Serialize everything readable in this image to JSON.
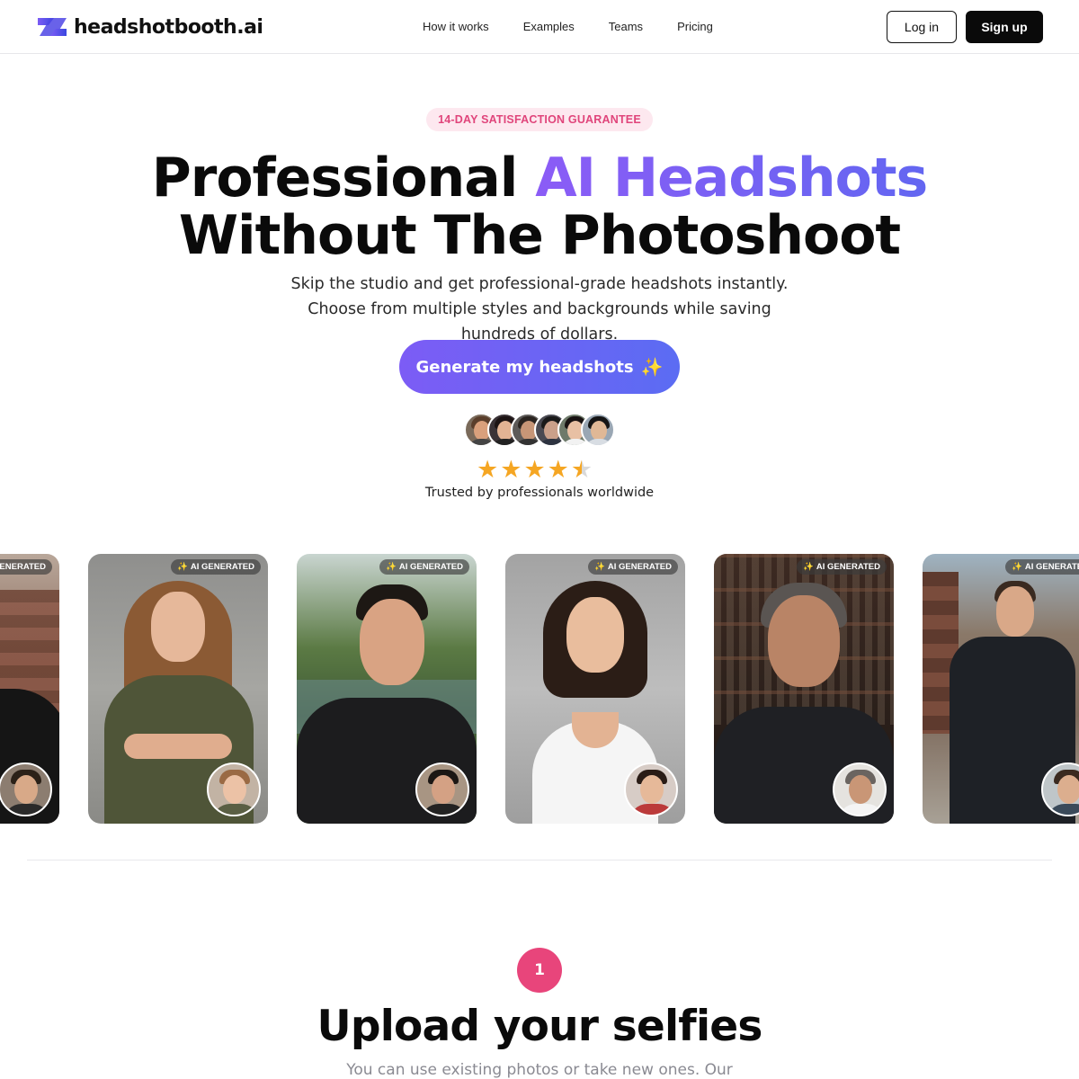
{
  "header": {
    "logo_text": "headshotbooth.ai",
    "nav": [
      "How it works",
      "Examples",
      "Teams",
      "Pricing"
    ],
    "login_label": "Log in",
    "signup_label": "Sign up"
  },
  "hero": {
    "badge": "14-DAY SATISFACTION GUARANTEE",
    "title_part1": "Professional ",
    "title_highlight": "AI Headshots",
    "title_line2": "Without The Photoshoot",
    "subtitle": "Skip the studio and get professional-grade headshots instantly. Choose from multiple styles and backgrounds while saving hundreds of dollars.",
    "cta_label": "Generate my headshots",
    "cta_icon": "sparkles-icon",
    "rating": 4.5,
    "rating_max": 5,
    "trusted_text": "Trusted by professionals worldwide"
  },
  "gallery": {
    "badge_label": "AI GENERATED",
    "badge_icon": "sparkles-icon"
  },
  "step": {
    "number": "1",
    "title": "Upload your selfies",
    "subtitle": "You can use existing photos or take new ones. Our"
  },
  "colors": {
    "accent_purple": "#7c5cf5",
    "accent_pink": "#e8457b",
    "star": "#f5a623"
  }
}
